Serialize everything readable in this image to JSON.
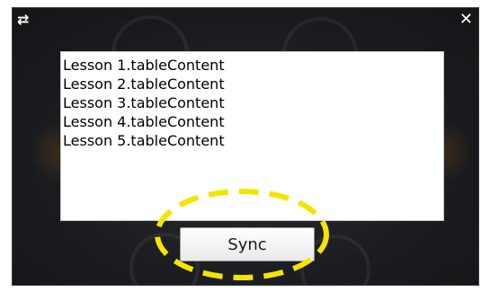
{
  "header": {
    "swap_icon": "swap-arrows-icon",
    "close_icon": "close-icon",
    "swap_glyph": "⇄",
    "close_glyph": "✕"
  },
  "list": {
    "items": [
      "Lesson 1.tableContent",
      "Lesson 2.tableContent",
      "Lesson 3.tableContent",
      "Lesson 4.tableContent",
      "Lesson 5.tableContent"
    ]
  },
  "footer": {
    "sync_label": "Sync"
  },
  "colors": {
    "dialog_background": "#1b1c1f",
    "highlight": "#f2e600",
    "list_background": "#ffffff"
  }
}
